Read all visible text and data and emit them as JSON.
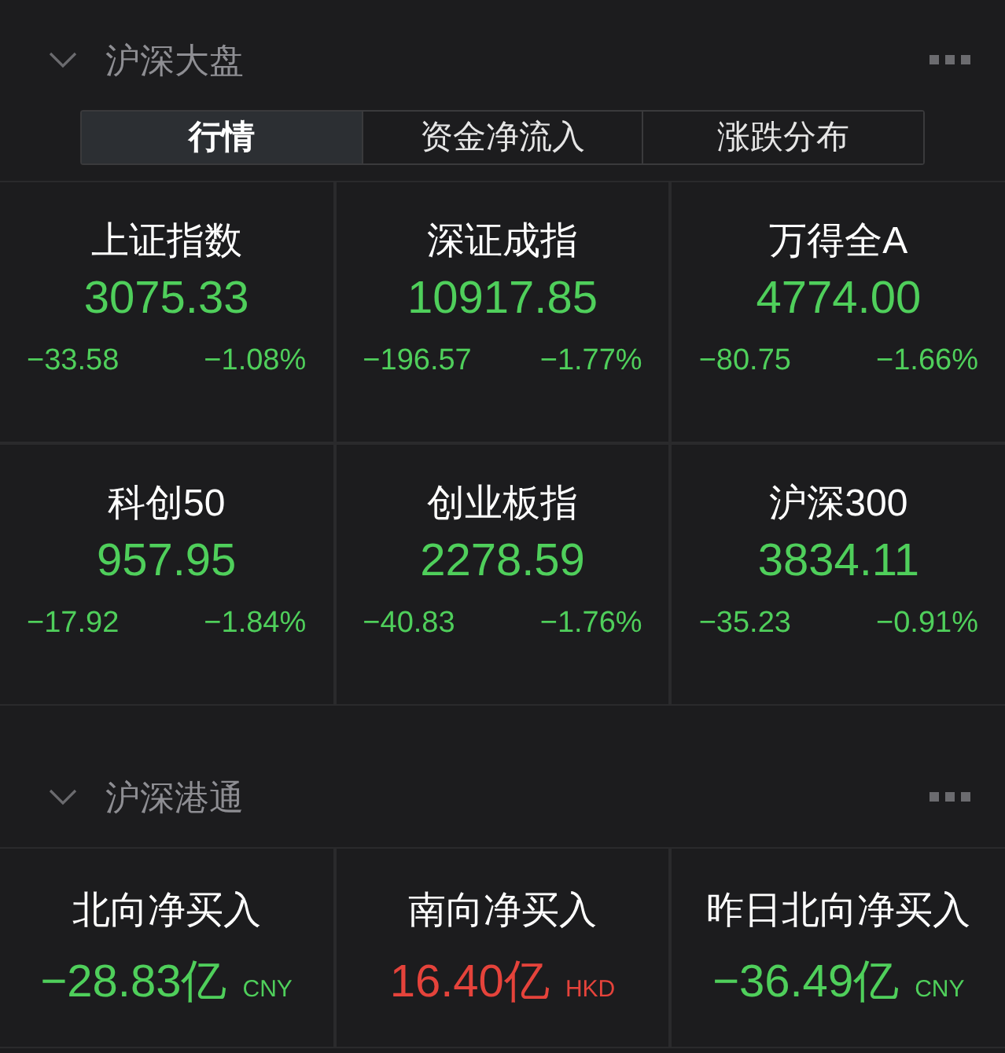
{
  "market_section": {
    "title": "沪深大盘",
    "expanded": true,
    "tabs": [
      {
        "label": "行情",
        "selected": true
      },
      {
        "label": "资金净流入",
        "selected": false
      },
      {
        "label": "涨跌分布",
        "selected": false
      }
    ],
    "indices": [
      {
        "name": "上证指数",
        "value": "3075.33",
        "change": "−33.58",
        "percent": "−1.08%",
        "color": "#4fcf5b"
      },
      {
        "name": "深证成指",
        "value": "10917.85",
        "change": "−196.57",
        "percent": "−1.77%",
        "color": "#4fcf5b"
      },
      {
        "name": "万得全A",
        "value": "4774.00",
        "change": "−80.75",
        "percent": "−1.66%",
        "color": "#4fcf5b"
      },
      {
        "name": "科创50",
        "value": "957.95",
        "change": "−17.92",
        "percent": "−1.84%",
        "color": "#4fcf5b"
      },
      {
        "name": "创业板指",
        "value": "2278.59",
        "change": "−40.83",
        "percent": "−1.76%",
        "color": "#4fcf5b"
      },
      {
        "name": "沪深300",
        "value": "3834.11",
        "change": "−35.23",
        "percent": "−0.91%",
        "color": "#4fcf5b"
      }
    ]
  },
  "connect_section": {
    "title": "沪深港通",
    "expanded": true,
    "flows": [
      {
        "name": "北向净买入",
        "value": "−28.83亿",
        "currency": "CNY",
        "color": "#4fcf5b"
      },
      {
        "name": "南向净买入",
        "value": "16.40亿",
        "currency": "HKD",
        "color": "#e5433b"
      },
      {
        "name": "昨日北向净买入",
        "value": "−36.49亿",
        "currency": "CNY",
        "color": "#4fcf5b"
      }
    ]
  }
}
